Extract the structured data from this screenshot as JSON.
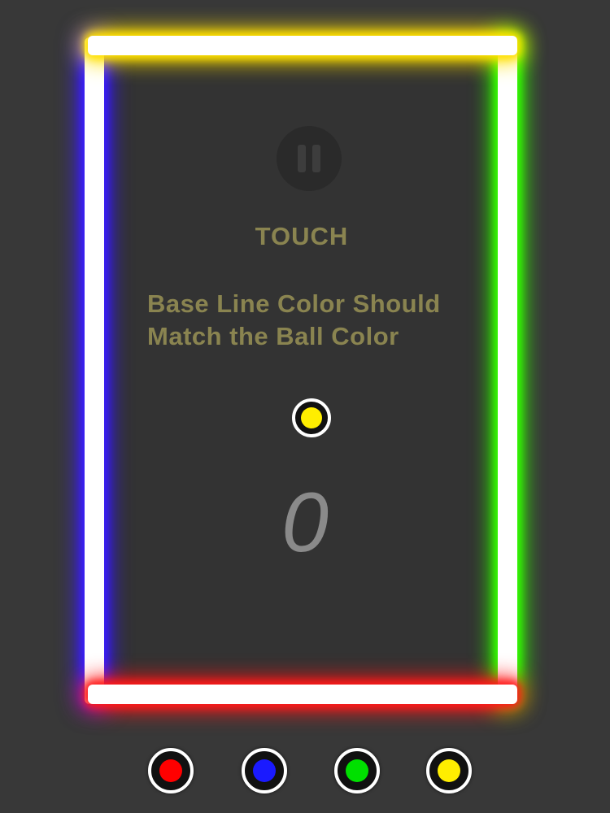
{
  "colors": {
    "top_wall": "#ffe000",
    "right_wall": "#33ff00",
    "bottom_wall": "#ff1a1a",
    "left_wall": "#3a1dff",
    "ball": "#ffee00"
  },
  "hud": {
    "pause_icon": "pause-icon",
    "touch_label": "TOUCH",
    "instruction_line1": "Base Line Color Should",
    "instruction_line2": "Match the Ball Color",
    "score": "0"
  },
  "palette": [
    {
      "name": "red",
      "color": "#ff0000"
    },
    {
      "name": "blue",
      "color": "#1a1aff"
    },
    {
      "name": "green",
      "color": "#00e000"
    },
    {
      "name": "yellow",
      "color": "#ffee00"
    }
  ]
}
